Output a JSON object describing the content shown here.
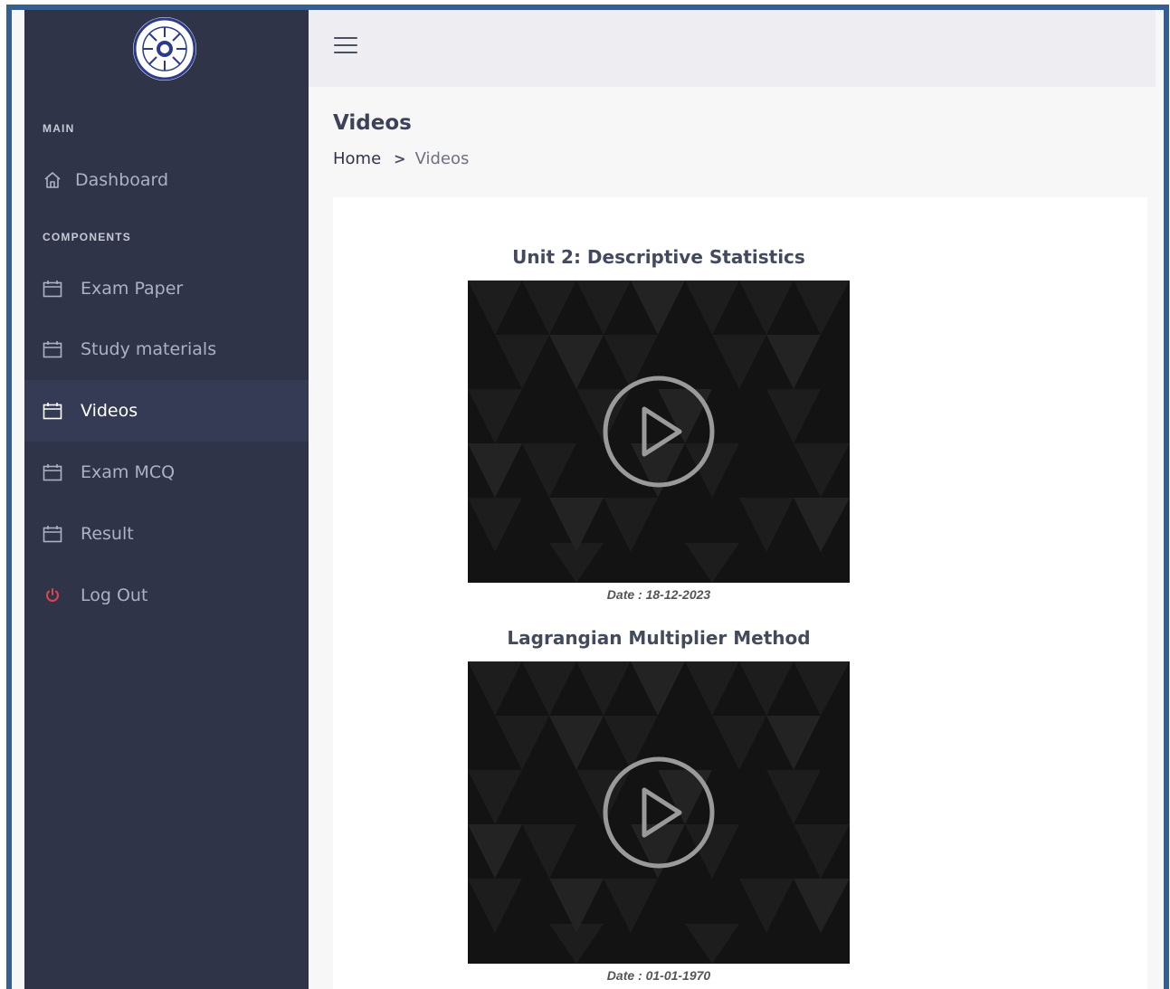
{
  "sidebar": {
    "logo_alt": "college logo",
    "sections": {
      "main": "MAIN",
      "components": "COMPONENTS"
    },
    "items": [
      {
        "label": "Dashboard",
        "icon": "home-icon"
      },
      {
        "label": "Exam Paper",
        "icon": "calendar-icon"
      },
      {
        "label": "Study materials",
        "icon": "calendar-icon"
      },
      {
        "label": "Videos",
        "icon": "calendar-icon",
        "active": true
      },
      {
        "label": "Exam MCQ",
        "icon": "calendar-icon"
      },
      {
        "label": "Result",
        "icon": "calendar-icon"
      },
      {
        "label": "Log Out",
        "icon": "power-icon"
      }
    ]
  },
  "header": {
    "menu_icon": "hamburger-icon"
  },
  "page": {
    "title": "Videos",
    "breadcrumb": {
      "home": "Home",
      "separator": ">",
      "current": "Videos"
    }
  },
  "videos": [
    {
      "title": "Unit 2: Descriptive Statistics",
      "date": "Date : 18-12-2023"
    },
    {
      "title": "Lagrangian Multiplier Method",
      "date": "Date : 01-01-1970"
    }
  ],
  "colors": {
    "sidebar_bg": "#2f3449",
    "sidebar_active_bg": "#353b54",
    "frame_border": "#365f91",
    "logout_icon": "#e0454f",
    "player_bg": "#131313"
  }
}
